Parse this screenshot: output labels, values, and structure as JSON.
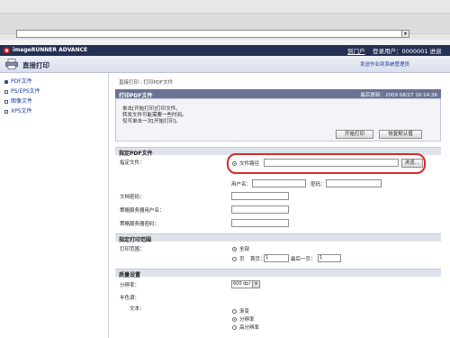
{
  "browser": {
    "address_value": "",
    "dropdown_icon": "chevron-down-icon"
  },
  "header": {
    "brand": "imageRUNNER ADVANCE",
    "portal_link": "到门户",
    "login_status": "登录用户：0000001 进退",
    "page_title": "直接打印",
    "top_link": "发送作业到系统管理员"
  },
  "sidebar": {
    "items": [
      {
        "label": "PDF文件",
        "active": true
      },
      {
        "label": "PS/EPS文件",
        "active": false
      },
      {
        "label": "图像文件",
        "active": false
      },
      {
        "label": "XPS文件",
        "active": false
      }
    ]
  },
  "breadcrumb": "直接打印 : 打印PDF文件",
  "print_section": {
    "title": "打印PDF文件",
    "last_updated": "最后更新：2009 08/27 16:14:36",
    "info_lines": [
      "单击[开始打印]打印文件。",
      "转发文件可能需要一些时间。",
      "仅可单击一次[开始打印]。"
    ],
    "start_button": "开始打印",
    "reset_button": "恢复默认值"
  },
  "specify_file": {
    "title": "指定PDF文件",
    "file_label": "指定文件：",
    "file_path_option": "文件路径",
    "file_path_value": "",
    "browse_button": "浏览...",
    "username_label": "用户名：",
    "username_value": "",
    "password_label": "密码：",
    "password_value": "",
    "doc_password_label": "文档密码：",
    "doc_password_value": "",
    "policy_user_label": "策略服务器用户名：",
    "policy_user_value": "",
    "policy_pass_label": "策略服务器密码：",
    "policy_pass_value": ""
  },
  "print_range": {
    "title": "指定打印范围",
    "label": "打印范围：",
    "option_all": "全部",
    "option_pages": "页",
    "first_label": "首页：",
    "first_value": "1",
    "last_label": "最后一页：",
    "last_value": "1",
    "selected": "all"
  },
  "quality": {
    "title": "质量设置",
    "resolution_label": "分辨率：",
    "resolution_value": "600 dpi",
    "halftone_label": "半色调：",
    "text_label": "文本：",
    "options": [
      "渐变",
      "分辨率",
      "高分辨率"
    ],
    "selected_index": 1
  },
  "colors": {
    "header_bg": "#253055",
    "section_bar": "#6a7394",
    "highlight": "#d82a2a",
    "link": "#1a3a9a"
  }
}
